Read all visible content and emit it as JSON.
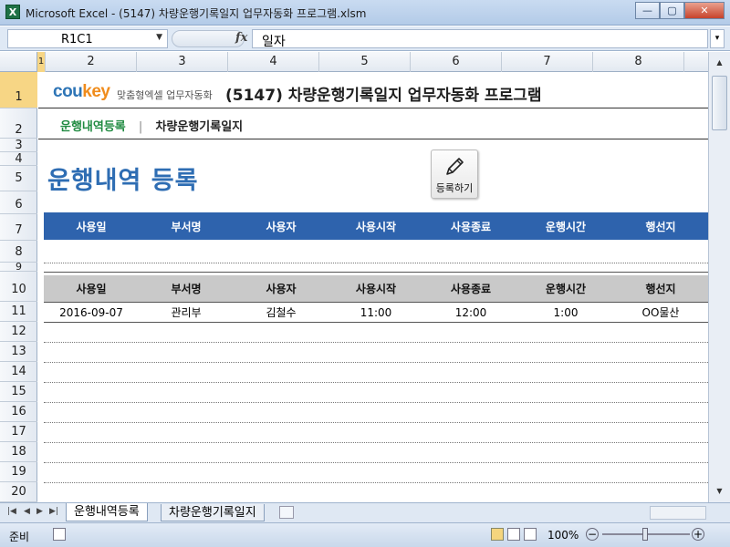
{
  "window": {
    "title": "Microsoft Excel - (5147) 차량운행기록일지 업무자동화 프로그램.xlsm",
    "minimize": "—",
    "restore": "▢",
    "close": "✕"
  },
  "formula_bar": {
    "name_box": "R1C1",
    "fx_label": "fx",
    "content": "일자"
  },
  "columns": [
    "1",
    "2",
    "3",
    "4",
    "5",
    "6",
    "7",
    "8"
  ],
  "rows": [
    "1",
    "2",
    "3",
    "4",
    "5",
    "6",
    "7",
    "8",
    "9",
    "10",
    "11",
    "12",
    "13",
    "14",
    "15",
    "16",
    "17",
    "18",
    "19",
    "20"
  ],
  "brand": {
    "logo_main": "cou",
    "logo_accent": "key",
    "sub": "맞춤형엑셀 업무자동화"
  },
  "doc_title": "(5147) 차량운행기록일지 업무자동화 프로그램",
  "nav": {
    "current": "운행내역등록",
    "separator": "|",
    "other": "차량운행기록일지"
  },
  "heading": "운행내역 등록",
  "register_button": "등록하기",
  "table_headers": [
    "사용일",
    "부서명",
    "사용자",
    "사용시작",
    "사용종료",
    "운행시간",
    "행선지"
  ],
  "records": [
    [
      "2016-09-07",
      "관리부",
      "김철수",
      "11:00",
      "12:00",
      "1:00",
      "OO물산"
    ]
  ],
  "sheet_tabs": [
    "운행내역등록",
    "차량운행기록일지"
  ],
  "status": {
    "mode": "준비",
    "zoom": "100%"
  }
}
